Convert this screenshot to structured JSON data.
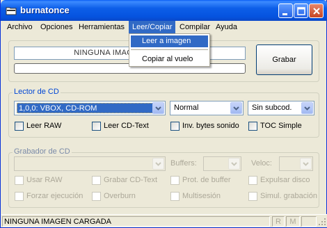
{
  "window": {
    "title": "burnatonce"
  },
  "menu": {
    "items": [
      "Archivo",
      "Opciones",
      "Herramientas",
      "Leer/Copiar",
      "Compilar",
      "Ayuda"
    ],
    "active": "Leer/Copiar",
    "dropdown": [
      "Leer a imagen",
      "Copiar al vuelo"
    ]
  },
  "top": {
    "status_text": "NINGUNA IMAGEN CARGADA",
    "status_visible": "NINGUNA IMAG",
    "progress": 0,
    "grabar_label": "Grabar"
  },
  "lector": {
    "title": "Lector de CD",
    "drive": "1,0,0: VBOX, CD-ROM",
    "mode": "Normal",
    "subcode": "Sin subcod.",
    "checks": [
      "Leer RAW",
      "Leer CD-Text",
      "Inv. bytes sonido",
      "TOC Simple"
    ]
  },
  "grabador": {
    "title": "Grabador de CD",
    "buffers_label": "Buffers:",
    "veloc_label": "Veloc:",
    "checks": [
      "Usar RAW",
      "Grabar CD-Text",
      "Prot. de buffer",
      "Expulsar disco",
      "Forzar ejecución",
      "Overburn",
      "Multisesión",
      "Simul. grabación"
    ]
  },
  "statusbar": {
    "text": "NINGUNA IMAGEN CARGADA",
    "r": "R",
    "m": "M"
  },
  "colors": {
    "accent": "#316ac5",
    "group_title": "#0046d5",
    "titlebar": "#0553df"
  }
}
